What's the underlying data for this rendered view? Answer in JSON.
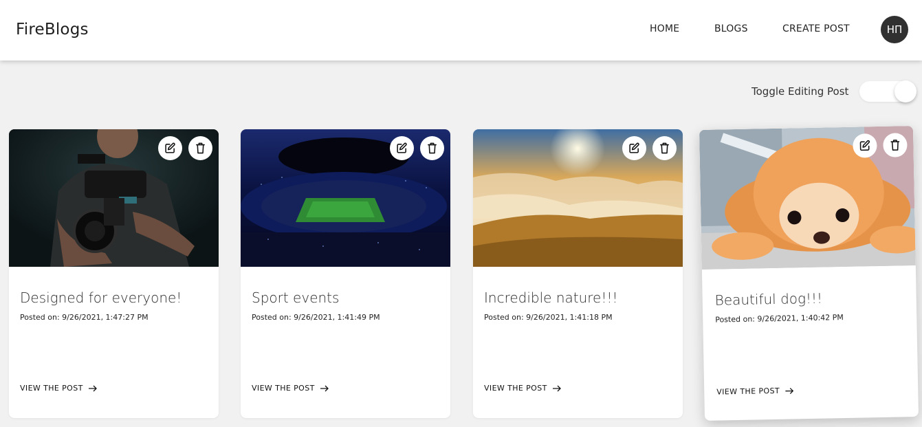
{
  "header": {
    "logo": "FireBlogs",
    "nav": {
      "home": "HOME",
      "blogs": "BLOGS",
      "create": "CREATE POST"
    },
    "avatar_initials": "НП"
  },
  "toggle": {
    "label": "Toggle Editing Post",
    "enabled": true
  },
  "cards": [
    {
      "title": "Designed for everyone!",
      "date": "Posted on: 9/26/2021, 1:47:27 PM",
      "link": "VIEW THE POST",
      "image": "photographer-with-camera-rig"
    },
    {
      "title": "Sport events",
      "date": "Posted on: 9/26/2021, 1:41:49 PM",
      "link": "VIEW THE POST",
      "image": "stadium-at-night"
    },
    {
      "title": "Incredible nature!!!",
      "date": "Posted on: 9/26/2021, 1:41:18 PM",
      "link": "VIEW THE POST",
      "image": "sunset-over-clouds-mountain"
    },
    {
      "title": "Beautiful dog!!!",
      "date": "Posted on: 9/26/2021, 1:40:42 PM",
      "link": "VIEW THE POST",
      "image": "pomeranian-puppy"
    }
  ],
  "icons": {
    "edit": "edit-icon",
    "delete": "trash-icon",
    "arrow": "arrow-right-icon"
  }
}
